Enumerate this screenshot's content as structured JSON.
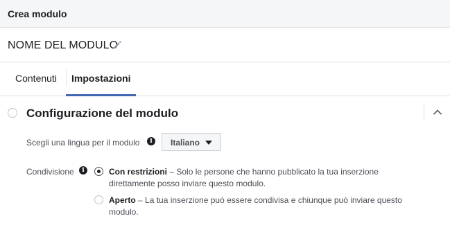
{
  "header": {
    "title": "Crea modulo"
  },
  "form": {
    "name": "NOME DEL MODULO"
  },
  "tabs": [
    {
      "label": "Contenuti",
      "active": false
    },
    {
      "label": "Impostazioni",
      "active": true
    }
  ],
  "section": {
    "title": "Configurazione del modulo",
    "language_label": "Scegli una lingua per il modulo",
    "language_value": "Italiano",
    "sharing_label": "Condivisione",
    "options": [
      {
        "title": "Con restrizioni",
        "description": " – Solo le persone che hanno pubblicato la tua inserzione direttamente posso inviare questo modulo.",
        "selected": true
      },
      {
        "title": "Aperto",
        "description": " – La tua inserzione può essere condivisa e chiunque può inviare questo modulo.",
        "selected": false
      }
    ]
  },
  "icons": {
    "edit": "pencil-icon",
    "info": "info-icon",
    "collapse": "chevron-up-icon",
    "dropdown": "caret-down-icon"
  },
  "colors": {
    "accent": "#4267b2",
    "header_bg": "#f5f6f7",
    "text": "#1c1e21",
    "secondary_text": "#4b4f56"
  }
}
